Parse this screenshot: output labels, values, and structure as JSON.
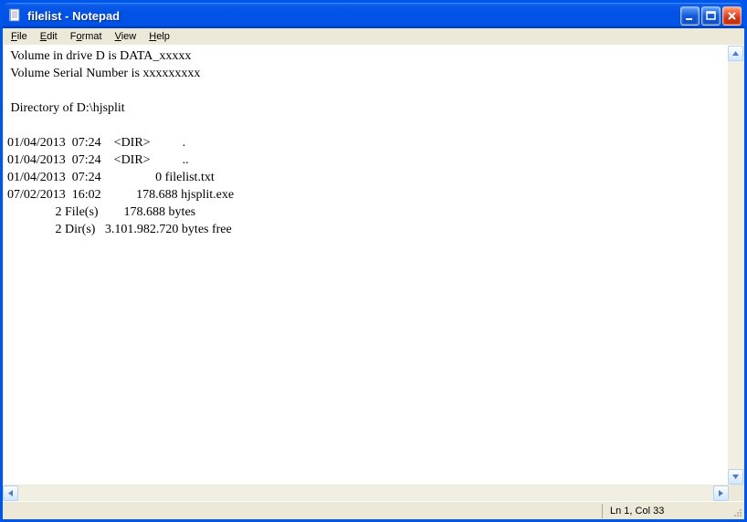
{
  "window": {
    "title": "filelist - Notepad"
  },
  "menu": {
    "file": "File",
    "edit": "Edit",
    "format": "Format",
    "view": "View",
    "help": "Help"
  },
  "content": {
    "line1": " Volume in drive D is DATA_xxxxx",
    "line2": " Volume Serial Number is xxxxxxxxx",
    "line3": "",
    "line4": " Directory of D:\\hjsplit",
    "line5": "",
    "line6": "01/04/2013  07:24    <DIR>          .",
    "line7": "01/04/2013  07:24    <DIR>          ..",
    "line8": "01/04/2013  07:24                 0 filelist.txt",
    "line9": "07/02/2013  16:02           178.688 hjsplit.exe",
    "line10": "               2 File(s)        178.688 bytes",
    "line11": "               2 Dir(s)   3.101.982.720 bytes free"
  },
  "status": {
    "position": "Ln 1, Col 33"
  }
}
